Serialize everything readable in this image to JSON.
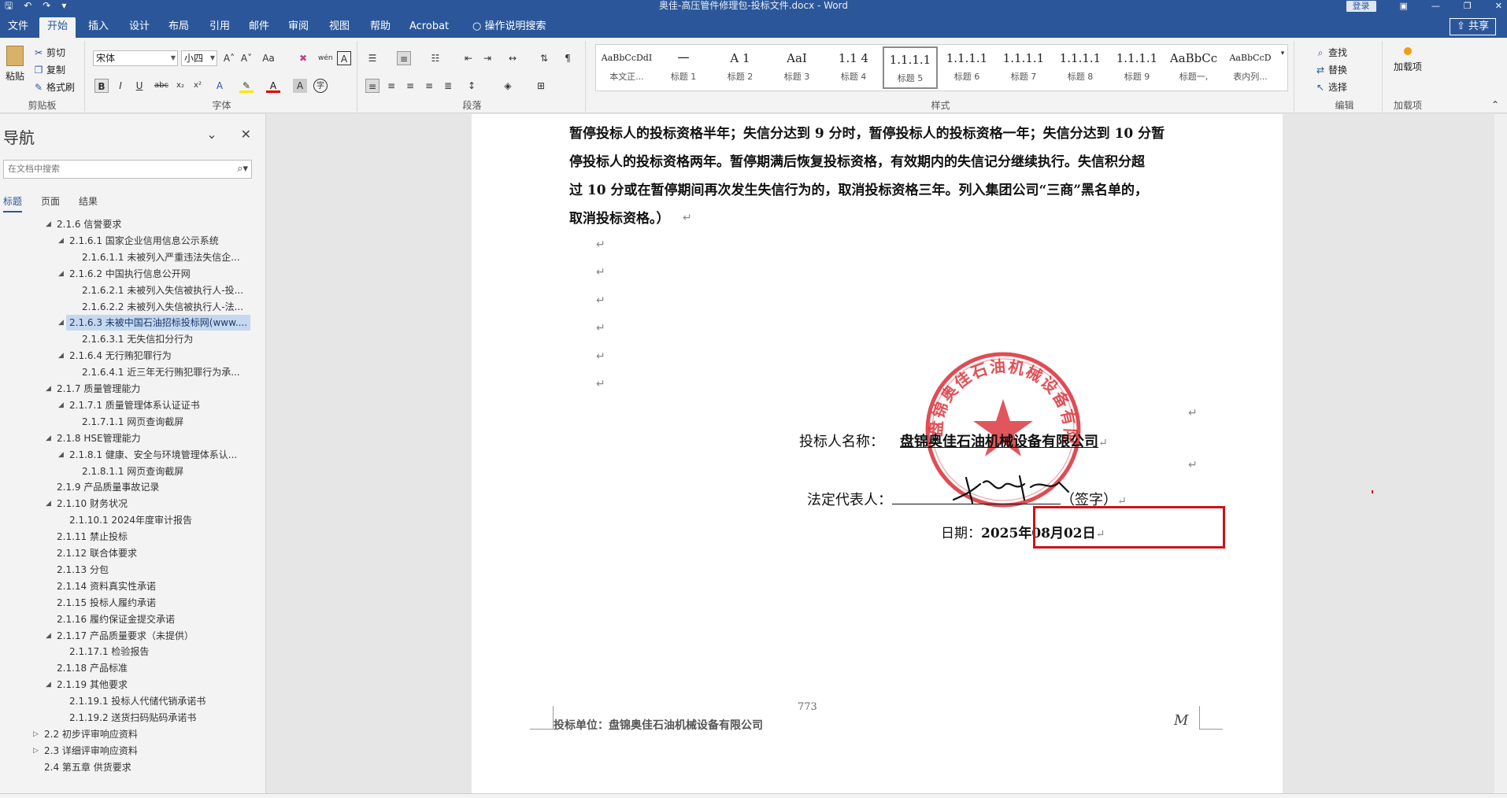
{
  "window": {
    "title": "奥佳-高压管件修理包-投标文件.docx  -  Word",
    "login": "登录"
  },
  "ribbon_tabs": [
    "文件",
    "开始",
    "插入",
    "设计",
    "布局",
    "引用",
    "邮件",
    "审阅",
    "视图",
    "帮助",
    "Acrobat",
    "操作说明搜索"
  ],
  "share": "共享",
  "clipboard": {
    "paste": "粘贴",
    "cut": "剪切",
    "copy": "复制",
    "format_painter": "格式刷",
    "label": "剪贴板"
  },
  "font": {
    "name": "宋体",
    "size": "小四",
    "label": "字体"
  },
  "paragraph": {
    "label": "段落"
  },
  "styles": {
    "label": "样式",
    "items": [
      {
        "sample": "AaBbCcDdI",
        "name": "本文正...",
        "small": true
      },
      {
        "sample": "一",
        "name": "标题 1"
      },
      {
        "sample": "A 1",
        "name": "标题 2"
      },
      {
        "sample": "AaI",
        "name": "标题 3"
      },
      {
        "sample": "1.1 4",
        "name": "标题 4"
      },
      {
        "sample": "1.1.1.1",
        "name": "标题 5"
      },
      {
        "sample": "1.1.1.1",
        "name": "标题 6"
      },
      {
        "sample": "1.1.1.1",
        "name": "标题 7"
      },
      {
        "sample": "1.1.1.1",
        "name": "标题 8"
      },
      {
        "sample": "1.1.1.1",
        "name": "标题 9"
      },
      {
        "sample": "AaBbCc",
        "name": "标题一,"
      },
      {
        "sample": "AaBbCcD",
        "name": "表内列...",
        "small": true
      }
    ],
    "selected_index": 5
  },
  "editing": {
    "find": "查找",
    "replace": "替换",
    "select": "选择",
    "label": "编辑"
  },
  "addins": {
    "button": "加载项",
    "label": "加载项"
  },
  "nav": {
    "title": "导航",
    "search_placeholder": "在文档中搜索",
    "tabs": [
      "标题",
      "页面",
      "结果"
    ],
    "items": [
      {
        "text": "2.1.6 信誉要求",
        "level": 2,
        "expanded": true
      },
      {
        "text": "2.1.6.1 国家企业信用信息公示系统",
        "level": 3,
        "expanded": true
      },
      {
        "text": "2.1.6.1.1 未被列入严重违法失信企...",
        "level": 4
      },
      {
        "text": "2.1.6.2 中国执行信息公开网",
        "level": 3,
        "expanded": true
      },
      {
        "text": "2.1.6.2.1 未被列入失信被执行人-投...",
        "level": 4
      },
      {
        "text": "2.1.6.2.2 未被列入失信被执行人-法...",
        "level": 4
      },
      {
        "text": "2.1.6.3 未被中国石油招标投标网(www....",
        "level": 3,
        "expanded": true,
        "selected": true
      },
      {
        "text": "2.1.6.3.1 无失信扣分行为",
        "level": 4
      },
      {
        "text": "2.1.6.4 无行贿犯罪行为",
        "level": 3,
        "expanded": true
      },
      {
        "text": "2.1.6.4.1 近三年无行贿犯罪行为承...",
        "level": 4
      },
      {
        "text": "2.1.7 质量管理能力",
        "level": 2,
        "expanded": true
      },
      {
        "text": "2.1.7.1 质量管理体系认证证书",
        "level": 3,
        "expanded": true
      },
      {
        "text": "2.1.7.1.1 网页查询截屏",
        "level": 4
      },
      {
        "text": "2.1.8 HSE管理能力",
        "level": 2,
        "expanded": true
      },
      {
        "text": "2.1.8.1 健康、安全与环境管理体系认...",
        "level": 3,
        "expanded": true
      },
      {
        "text": "2.1.8.1.1 网页查询截屏",
        "level": 4
      },
      {
        "text": "2.1.9 产品质量事故记录",
        "level": 2
      },
      {
        "text": "2.1.10 财务状况",
        "level": 2,
        "expanded": true
      },
      {
        "text": "2.1.10.1 2024年度审计报告",
        "level": 3
      },
      {
        "text": "2.1.11 禁止投标",
        "level": 2
      },
      {
        "text": "2.1.12 联合体要求",
        "level": 2
      },
      {
        "text": "2.1.13 分包",
        "level": 2
      },
      {
        "text": "2.1.14 资料真实性承诺",
        "level": 2
      },
      {
        "text": "2.1.15 投标人履约承诺",
        "level": 2
      },
      {
        "text": "2.1.16 履约保证金提交承诺",
        "level": 2
      },
      {
        "text": "2.1.17 产品质量要求（未提供）",
        "level": 2,
        "expanded": true
      },
      {
        "text": "2.1.17.1 检验报告",
        "level": 3
      },
      {
        "text": "2.1.18 产品标准",
        "level": 2
      },
      {
        "text": "2.1.19 其他要求",
        "level": 2,
        "expanded": true
      },
      {
        "text": "2.1.19.1 投标人代储代销承诺书",
        "level": 3
      },
      {
        "text": "2.1.19.2 送货扫码贴码承诺书",
        "level": 3
      },
      {
        "text": "2.2 初步评审响应资料",
        "level": 1,
        "collapsed": true
      },
      {
        "text": "2.3 详细评审响应资料",
        "level": 1,
        "collapsed": true
      },
      {
        "text": "2.4 第五章 供货要求",
        "level": 1
      }
    ]
  },
  "document": {
    "paragraph_lines": [
      "暂停投标人的投标资格半年；失信分达到 9 分时，暂停投标人的投标资格一年；失信分达到 10 分暂",
      "停投标人的投标资格两年。暂停期满后恢复投标资格，有效期内的失信记分继续执行。失信积分超",
      "过 10 分或在暂停期间再次发生失信行为的，取消投标资格三年。列入集团公司“三商”黑名单的，",
      "取消投标资格。）"
    ],
    "bidder_label": "投标人名称：",
    "bidder_name": "盘锦奥佳石油机械设备有限公司",
    "legal_rep_label": "法定代表人：",
    "signature_note": "（签字）",
    "date_label": "日期：",
    "date_value": "2025年08月02日",
    "stamp_text": "盘锦奥佳石油机械设备有限公司",
    "signature_mark": "莫东利",
    "page_number": "773",
    "footer": "投标单位：盘锦奥佳石油机械设备有限公司",
    "footer_mark": "M"
  },
  "colors": {
    "accent": "#2b579a",
    "stamp_red": "#d8262e",
    "highlight_box": "#c9141b"
  }
}
